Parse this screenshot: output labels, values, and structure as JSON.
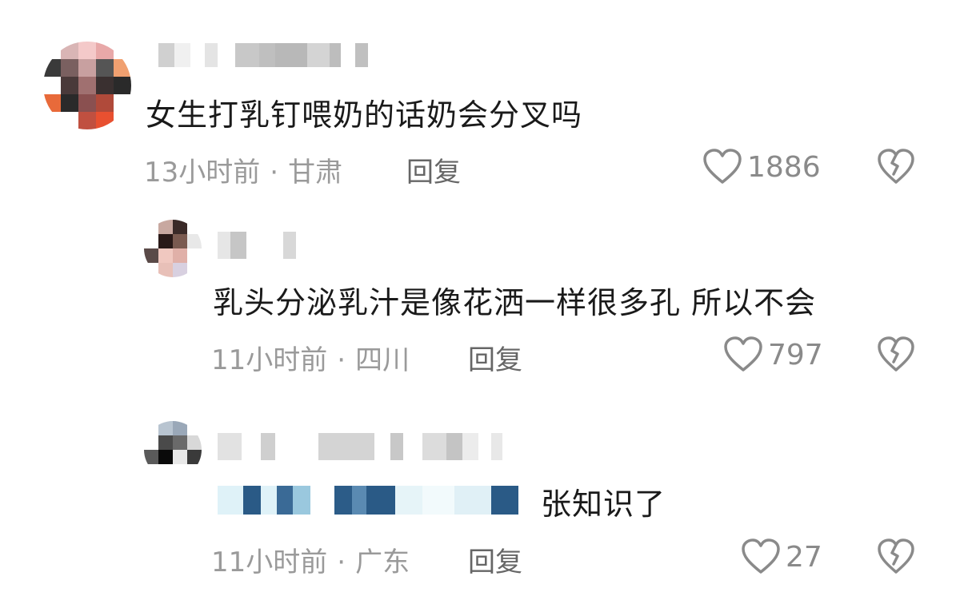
{
  "comments": [
    {
      "text": "女生打乳钉喂奶的话奶会分叉吗",
      "time": "13小时前",
      "location": "甘肃",
      "reply_label": "回复",
      "likes": "1886"
    },
    {
      "text": "乳头分泌乳汁是像花洒一样很多孔 所以不会",
      "time": "11小时前",
      "location": "四川",
      "reply_label": "回复",
      "likes": "797"
    },
    {
      "text": "张知识了",
      "time": "11小时前",
      "location": "广东",
      "reply_label": "回复",
      "likes": "27"
    }
  ],
  "separator": "·",
  "icons": {
    "like": "heart-outline-icon",
    "dislike": "broken-heart-icon"
  }
}
